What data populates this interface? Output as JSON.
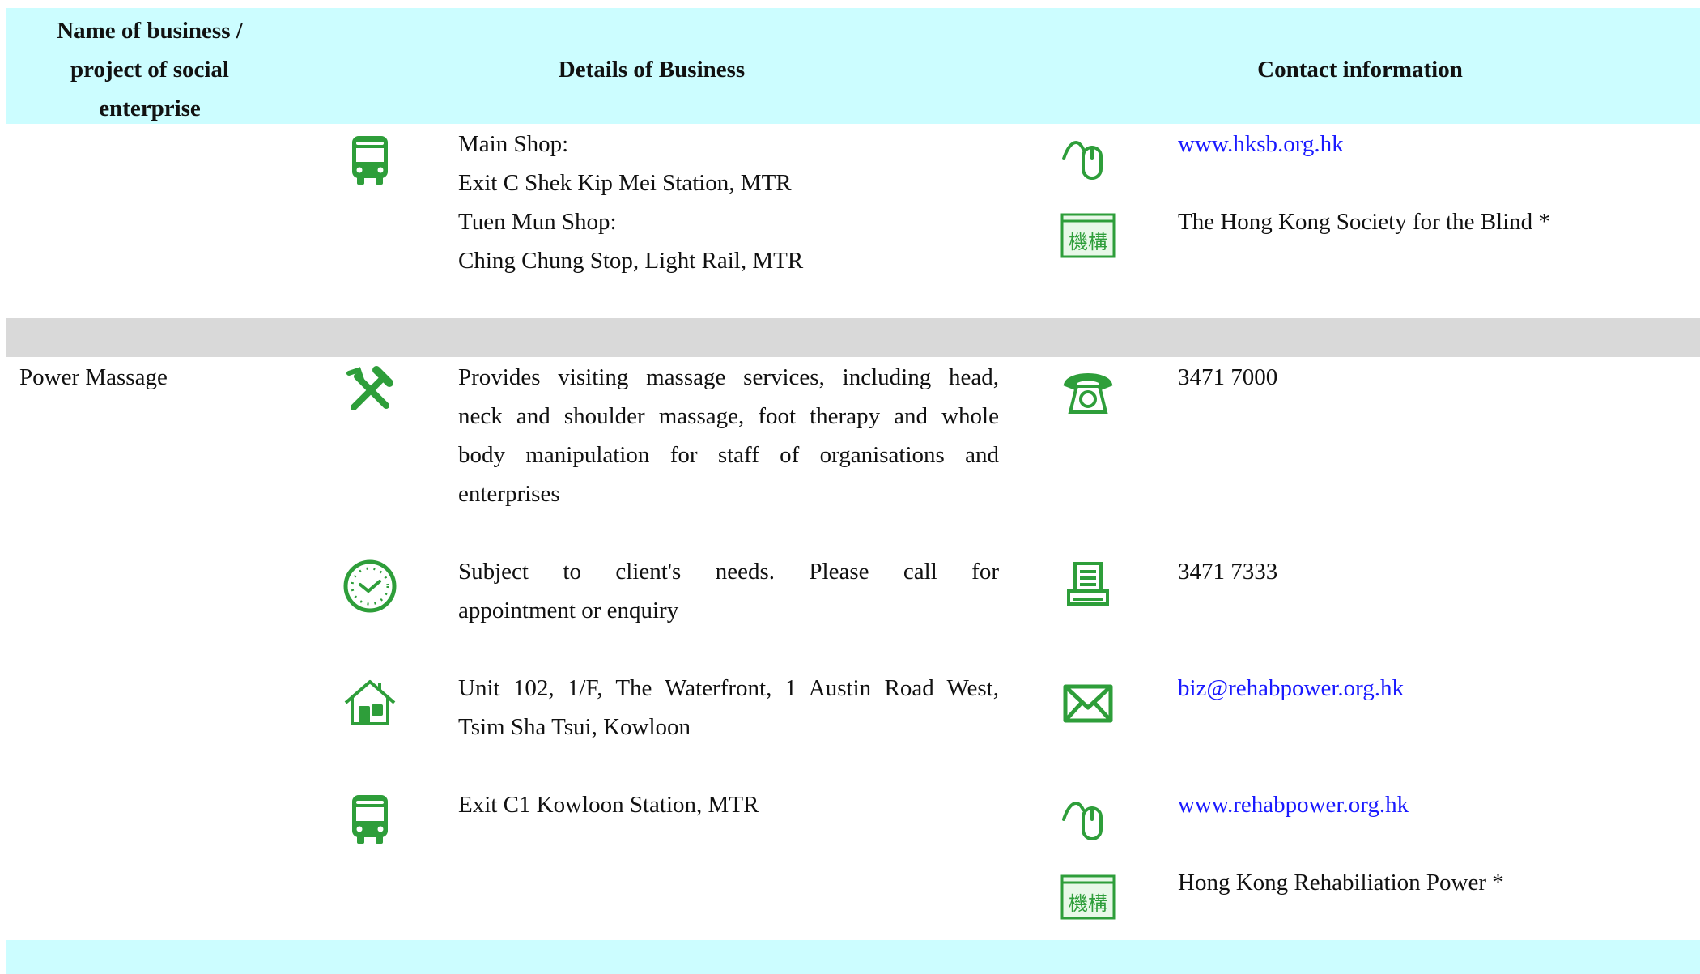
{
  "header": {
    "col1": "Name of business / project of social enterprise",
    "col2": "Details of Business",
    "col3": "Contact information"
  },
  "entry1": {
    "details": {
      "transport_lines": [
        "Main Shop:",
        "Exit C Shek Kip Mei Station, MTR",
        "Tuen Mun Shop:",
        "Ching Chung Stop, Light Rail, MTR"
      ]
    },
    "contact": {
      "website": "www.hksb.org.hk",
      "organisation": "The Hong Kong Society for the Blind *"
    }
  },
  "entry2": {
    "name": "Power Massage",
    "details": {
      "service_lines": [
        "Provides visiting massage services, including head,",
        "neck and shoulder massage, foot therapy and whole",
        "body manipulation for staff of organisations and",
        "enterprises"
      ],
      "hours_lines": [
        "Subject to client's needs. Please call for",
        "appointment or enquiry"
      ],
      "address_lines": [
        "Unit 102, 1/F, The Waterfront, 1 Austin Road West,",
        "Tsim Sha Tsui, Kowloon"
      ],
      "transport": "Exit C1 Kowloon Station, MTR"
    },
    "contact": {
      "phone": "3471 7000",
      "fax": "3471 7333",
      "email": "biz@rehabpower.org.hk",
      "website": "www.rehabpower.org.hk",
      "organisation": "Hong Kong Rehabiliation Power *"
    }
  },
  "icons": {
    "bus": "bus-icon",
    "tools": "tools-icon",
    "clock": "clock-icon",
    "house": "house-icon",
    "phone": "telephone-icon",
    "fax": "fax-icon",
    "email": "envelope-icon",
    "web": "mouse-web-icon",
    "org": "organisation-icon",
    "org_glyph": "機構"
  },
  "colors": {
    "header_band": "#ccfdff",
    "separator_band": "#d9d9d9",
    "icon_green": "#2e9e3a",
    "link_blue": "#1a1aff"
  }
}
